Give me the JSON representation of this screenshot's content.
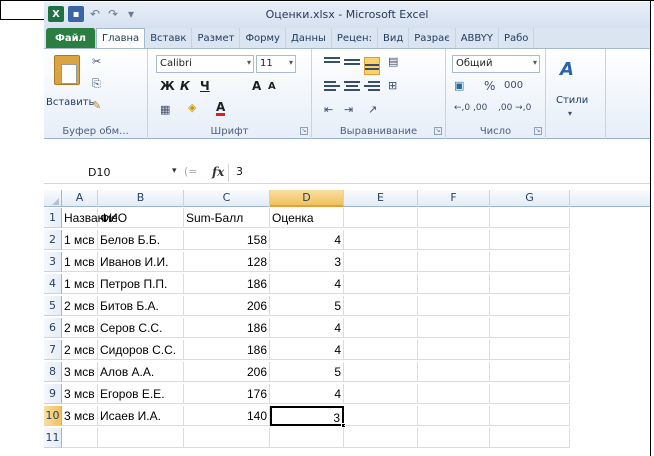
{
  "window": {
    "title": "Оценки.xlsx - Microsoft Excel",
    "qat": {
      "undo_glyph": "↶",
      "redo_glyph": "↷",
      "more_glyph": "▾"
    }
  },
  "ribbon_tabs": [
    {
      "label": "Файл",
      "active": false
    },
    {
      "label": "Главна",
      "active": true
    },
    {
      "label": "Вставк",
      "active": false
    },
    {
      "label": "Размет",
      "active": false
    },
    {
      "label": "Форму",
      "active": false
    },
    {
      "label": "Данны",
      "active": false
    },
    {
      "label": "Рецен:",
      "active": false
    },
    {
      "label": "Вид",
      "active": false
    },
    {
      "label": "Разрає",
      "active": false
    },
    {
      "label": "ABBYY",
      "active": false
    },
    {
      "label": "Рабо",
      "active": false
    }
  ],
  "ribbon": {
    "clipboard": {
      "paste_label": "Вставить",
      "group_label": "Буфер обм...",
      "launcher": "⌐"
    },
    "font": {
      "font_name": "Calibri",
      "font_size": "11",
      "group_label": "Шрифт",
      "bold": "Ж",
      "italic": "К",
      "underline": "Ч",
      "grow": "A",
      "shrink": "A",
      "font_color_letter": "A"
    },
    "alignment": {
      "group_label": "Выравнивание"
    },
    "number": {
      "format": "Общий",
      "percent": "%",
      "thousands": "000",
      "inc_dec": "←,0 ,00",
      "dec_dec": ",00 →,0",
      "group_label": "Число"
    },
    "styles": {
      "label": "Стили"
    }
  },
  "formula_bar": {
    "name_box": "D10",
    "fx": "fx",
    "value": "3"
  },
  "grid": {
    "columns": [
      "A",
      "B",
      "C",
      "D",
      "E",
      "F",
      "G"
    ],
    "active_column": "D",
    "active_row": "10",
    "rows": [
      {
        "n": "1",
        "cells": [
          "Название",
          "ФИО",
          "Sum-Балл",
          "Оценка"
        ]
      },
      {
        "n": "2",
        "cells": [
          "1 мсв",
          "Белов Б.Б.",
          "158",
          "4"
        ]
      },
      {
        "n": "3",
        "cells": [
          "1 мсв",
          "Иванов И.И.",
          "128",
          "3"
        ]
      },
      {
        "n": "4",
        "cells": [
          "1 мсв",
          "Петров П.П.",
          "186",
          "4"
        ]
      },
      {
        "n": "5",
        "cells": [
          "2 мсв",
          "Битов Б.А.",
          "206",
          "5"
        ]
      },
      {
        "n": "6",
        "cells": [
          "2 мсв",
          "Серов С.С.",
          "186",
          "4"
        ]
      },
      {
        "n": "7",
        "cells": [
          "2 мсв",
          "Сидоров С.С.",
          "186",
          "4"
        ]
      },
      {
        "n": "8",
        "cells": [
          "3 мсв",
          "Алов А.А.",
          "206",
          "5"
        ]
      },
      {
        "n": "9",
        "cells": [
          "3 мсв",
          "Егоров Е.Е.",
          "176",
          "4"
        ]
      },
      {
        "n": "10",
        "cells": [
          "3 мсв",
          "Исаев И.А.",
          "140",
          "3"
        ]
      },
      {
        "n": "11",
        "cells": [
          "",
          "",
          "",
          ""
        ]
      }
    ]
  },
  "colors": {
    "file_tab": "#2a7e42",
    "selection_header": "#f1c15f",
    "excel_green": "#1e7145"
  }
}
